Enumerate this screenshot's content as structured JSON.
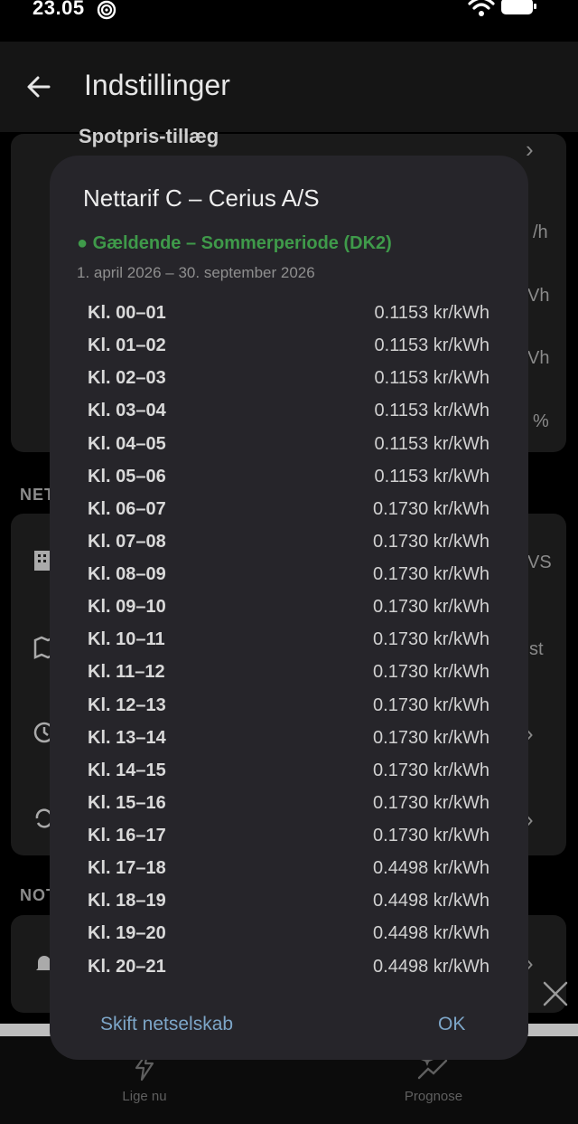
{
  "status_bar": {
    "time": "23.05"
  },
  "app_bar": {
    "title": "Indstillinger"
  },
  "background": {
    "card_title": "Spotpris-tillæg",
    "section_net": "NET",
    "section_notifications": "NOT",
    "right_fragments": [
      "/h",
      "Vh",
      "Vh",
      "%",
      "VS",
      "st"
    ]
  },
  "dialog": {
    "title": "Nettarif C – Cerius A/S",
    "status": "● Gældende – Sommerperiode (DK2)",
    "period": "1. april 2026 – 30. september 2026",
    "rows": [
      {
        "hour": "Kl. 00–01",
        "price": "0.1153 kr/kWh"
      },
      {
        "hour": "Kl. 01–02",
        "price": "0.1153 kr/kWh"
      },
      {
        "hour": "Kl. 02–03",
        "price": "0.1153 kr/kWh"
      },
      {
        "hour": "Kl. 03–04",
        "price": "0.1153 kr/kWh"
      },
      {
        "hour": "Kl. 04–05",
        "price": "0.1153 kr/kWh"
      },
      {
        "hour": "Kl. 05–06",
        "price": "0.1153 kr/kWh"
      },
      {
        "hour": "Kl. 06–07",
        "price": "0.1730 kr/kWh"
      },
      {
        "hour": "Kl. 07–08",
        "price": "0.1730 kr/kWh"
      },
      {
        "hour": "Kl. 08–09",
        "price": "0.1730 kr/kWh"
      },
      {
        "hour": "Kl. 09–10",
        "price": "0.1730 kr/kWh"
      },
      {
        "hour": "Kl. 10–11",
        "price": "0.1730 kr/kWh"
      },
      {
        "hour": "Kl. 11–12",
        "price": "0.1730 kr/kWh"
      },
      {
        "hour": "Kl. 12–13",
        "price": "0.1730 kr/kWh"
      },
      {
        "hour": "Kl. 13–14",
        "price": "0.1730 kr/kWh"
      },
      {
        "hour": "Kl. 14–15",
        "price": "0.1730 kr/kWh"
      },
      {
        "hour": "Kl. 15–16",
        "price": "0.1730 kr/kWh"
      },
      {
        "hour": "Kl. 16–17",
        "price": "0.1730 kr/kWh"
      },
      {
        "hour": "Kl. 17–18",
        "price": "0.4498 kr/kWh"
      },
      {
        "hour": "Kl. 18–19",
        "price": "0.4498 kr/kWh"
      },
      {
        "hour": "Kl. 19–20",
        "price": "0.4498 kr/kWh"
      },
      {
        "hour": "Kl. 20–21",
        "price": "0.4498 kr/kWh"
      }
    ],
    "change_button": "Skift netselskab",
    "ok_button": "OK"
  },
  "bottom_nav": {
    "items": [
      {
        "label": "Lige nu",
        "icon": "lightning-icon"
      },
      {
        "label": "Prognose",
        "icon": "sparkles-trend-icon"
      }
    ]
  },
  "colors": {
    "dialog_bg": "#26252a",
    "status_green": "#3f9a4a",
    "button_blue": "#7da6c8"
  }
}
